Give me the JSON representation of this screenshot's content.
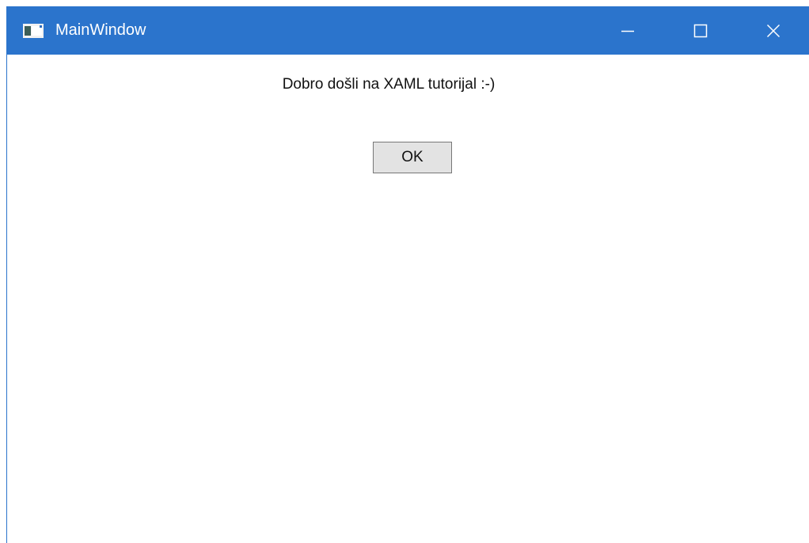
{
  "window": {
    "title": "MainWindow",
    "accent_color": "#2b74cc",
    "app_icon": "application-window-icon",
    "controls": {
      "minimize_icon": "minimize-icon",
      "maximize_icon": "maximize-icon",
      "close_icon": "close-icon"
    }
  },
  "content": {
    "welcome_text": "Dobro došli na XAML tutorijal :-)",
    "ok_label": "OK"
  }
}
